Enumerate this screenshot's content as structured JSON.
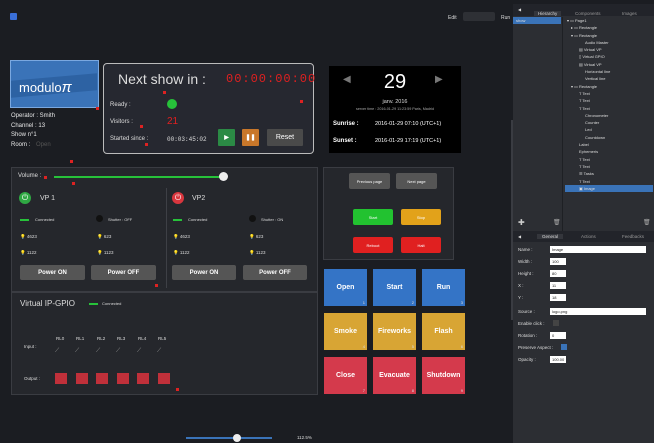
{
  "topbar": {
    "edit": "Edit",
    "run": "Run"
  },
  "hierarchy": {
    "tabs": [
      "Hierarchy",
      "Components",
      "Images"
    ],
    "show_label": "show",
    "items": [
      "Page1",
      "Rectangle",
      "Rectangle",
      "Audio Master",
      "Virtual VP",
      "Virtual GPIO",
      "Virtual VP",
      "Horizontal line",
      "Vertical line",
      "Rectangle",
      "Text",
      "Text",
      "Text",
      "Chronometer",
      "Counter",
      "Led",
      "Countdown",
      "Label",
      "Ephemeris",
      "Text",
      "Text",
      "Tasks",
      "Text",
      "Image"
    ]
  },
  "inspector": {
    "tabs": [
      "General",
      "Actions",
      "Feedbacks"
    ],
    "name_label": "Name :",
    "name": "Image",
    "width_label": "Width :",
    "width": "100",
    "height_label": "Height :",
    "height": "80",
    "x_label": "X :",
    "x": "11",
    "y_label": "Y :",
    "y": "18",
    "source_label": "Source :",
    "source": "logo.png",
    "enable_click_label": "Enable click :",
    "rotation_label": "Rotation :",
    "rotation": "0",
    "preserve_label": "Preserve Aspect :",
    "opacity_label": "Opacity :",
    "opacity": "100.00"
  },
  "logo": {
    "text": "modulo",
    "pi": "π"
  },
  "operator": {
    "line1": "Operator : Smith",
    "line2": "Channel : 13",
    "line3": "Show n°1",
    "room_label": "Room :",
    "room_value": "Open"
  },
  "next_show": {
    "title": "Next show in :",
    "countdown": "00:00:00:00",
    "ready_label": "Ready :",
    "visitors_label": "Visitors :",
    "visitors": "21",
    "started_label": "Started since :",
    "started": "00:03:45:02",
    "reset": "Reset"
  },
  "calendar": {
    "day": "29",
    "month": "janv. 2016",
    "server_time": "server time : 2016-01-29 11:23:59 Paris, Madrid",
    "sunrise_label": "Sunrise :",
    "sunrise": "2016-01-29 07:10 (UTC+1)",
    "sunset_label": "Sunset :",
    "sunset": "2016-01-29 17:19 (UTC+1)"
  },
  "volume": {
    "label": "Volume :"
  },
  "vp1": {
    "title": "VP 1",
    "connected": "Connected",
    "shutter": "Shutter : OFF",
    "v1": "4623",
    "v2": "623",
    "v3": "1122",
    "v4": "1123",
    "on": "Power ON",
    "off": "Power OFF"
  },
  "vp2": {
    "title": "VP2",
    "connected": "Connected",
    "shutter": "Shutter : ON",
    "v1": "4623",
    "v2": "623",
    "v3": "1122",
    "v4": "1123",
    "on": "Power ON",
    "off": "Power OFF"
  },
  "gpio": {
    "title": "Virtual IP-GPIO",
    "connected": "Connected",
    "input_label": "Input :",
    "output_label": "Output :",
    "relays": [
      "RL0",
      "RL1",
      "RL2",
      "RL3",
      "RL4",
      "RL5"
    ]
  },
  "pages": {
    "prev": "Previous page",
    "next": "Next page",
    "start": "Start",
    "stop": "Stop",
    "reboot": "Reboot",
    "halt": "Halt"
  },
  "tiles": [
    {
      "label": "Open",
      "n": "1"
    },
    {
      "label": "Start",
      "n": "2"
    },
    {
      "label": "Run",
      "n": "3"
    },
    {
      "label": "Smoke",
      "n": "4"
    },
    {
      "label": "Fireworks",
      "n": "5"
    },
    {
      "label": "Flash",
      "n": "6"
    },
    {
      "label": "Close",
      "n": "7"
    },
    {
      "label": "Evacuate",
      "n": "8"
    },
    {
      "label": "Shutdown",
      "n": "9"
    }
  ],
  "zoom": "112.5%"
}
